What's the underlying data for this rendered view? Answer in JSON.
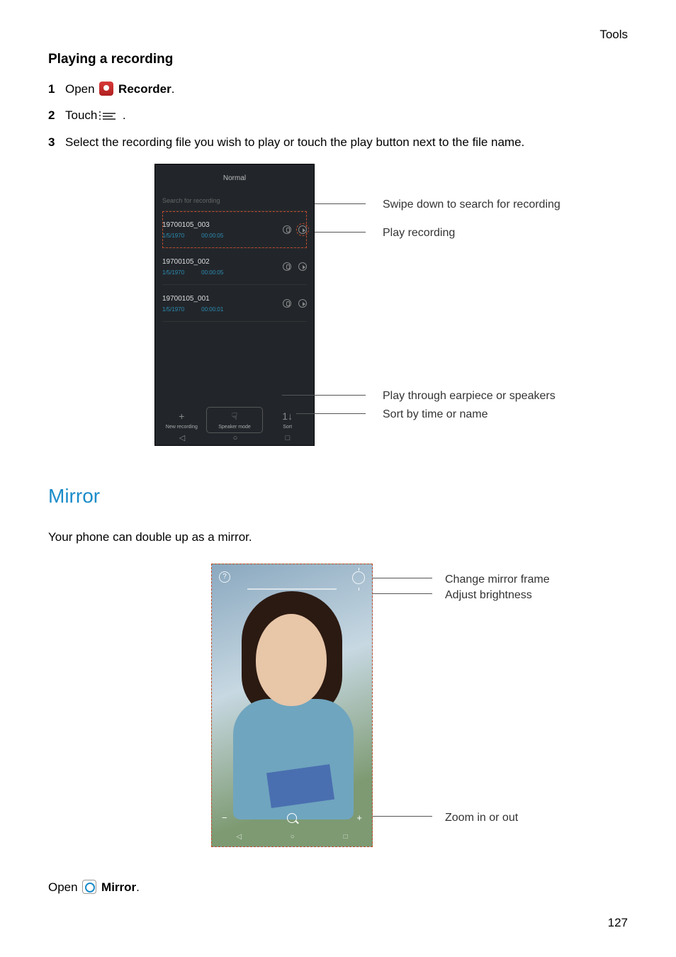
{
  "header": {
    "section": "Tools"
  },
  "playing": {
    "title": "Playing a recording",
    "steps": {
      "1": {
        "num": "1",
        "pre": "Open ",
        "post": ".",
        "app": "Recorder"
      },
      "2": {
        "num": "2",
        "pre": "Touch ",
        "post": " ."
      },
      "3": {
        "num": "3",
        "text": "Select the recording file you wish to play or touch the play button next to the file name."
      }
    }
  },
  "phone1": {
    "title": "Normal",
    "search_placeholder": "Search for recording",
    "recordings": [
      {
        "name": "19700105_003",
        "date": "1/5/1970",
        "dur": "00:00:05"
      },
      {
        "name": "19700105_002",
        "date": "1/5/1970",
        "dur": "00:00:05"
      },
      {
        "name": "19700105_001",
        "date": "1/5/1970",
        "dur": "00:00:01"
      }
    ],
    "bottom": {
      "new": {
        "sym": "+",
        "label": "New recording"
      },
      "mode": {
        "sym": "☟",
        "label": "Speaker mode"
      },
      "sort": {
        "sym": "1↓",
        "label": "Sort"
      }
    },
    "callouts": {
      "search": "Swipe down to search for recording",
      "play": "Play recording",
      "speaker": "Play through earpiece or speakers",
      "sort": "Sort by time or name"
    }
  },
  "mirror": {
    "heading": "Mirror",
    "intro": "Your phone can double up as a mirror.",
    "callouts": {
      "frame": "Change mirror frame",
      "brightness": "Adjust brightness",
      "zoom": "Zoom in or out"
    },
    "open_pre": "Open ",
    "open_app": "Mirror",
    "open_post": "."
  },
  "page_number": "127"
}
